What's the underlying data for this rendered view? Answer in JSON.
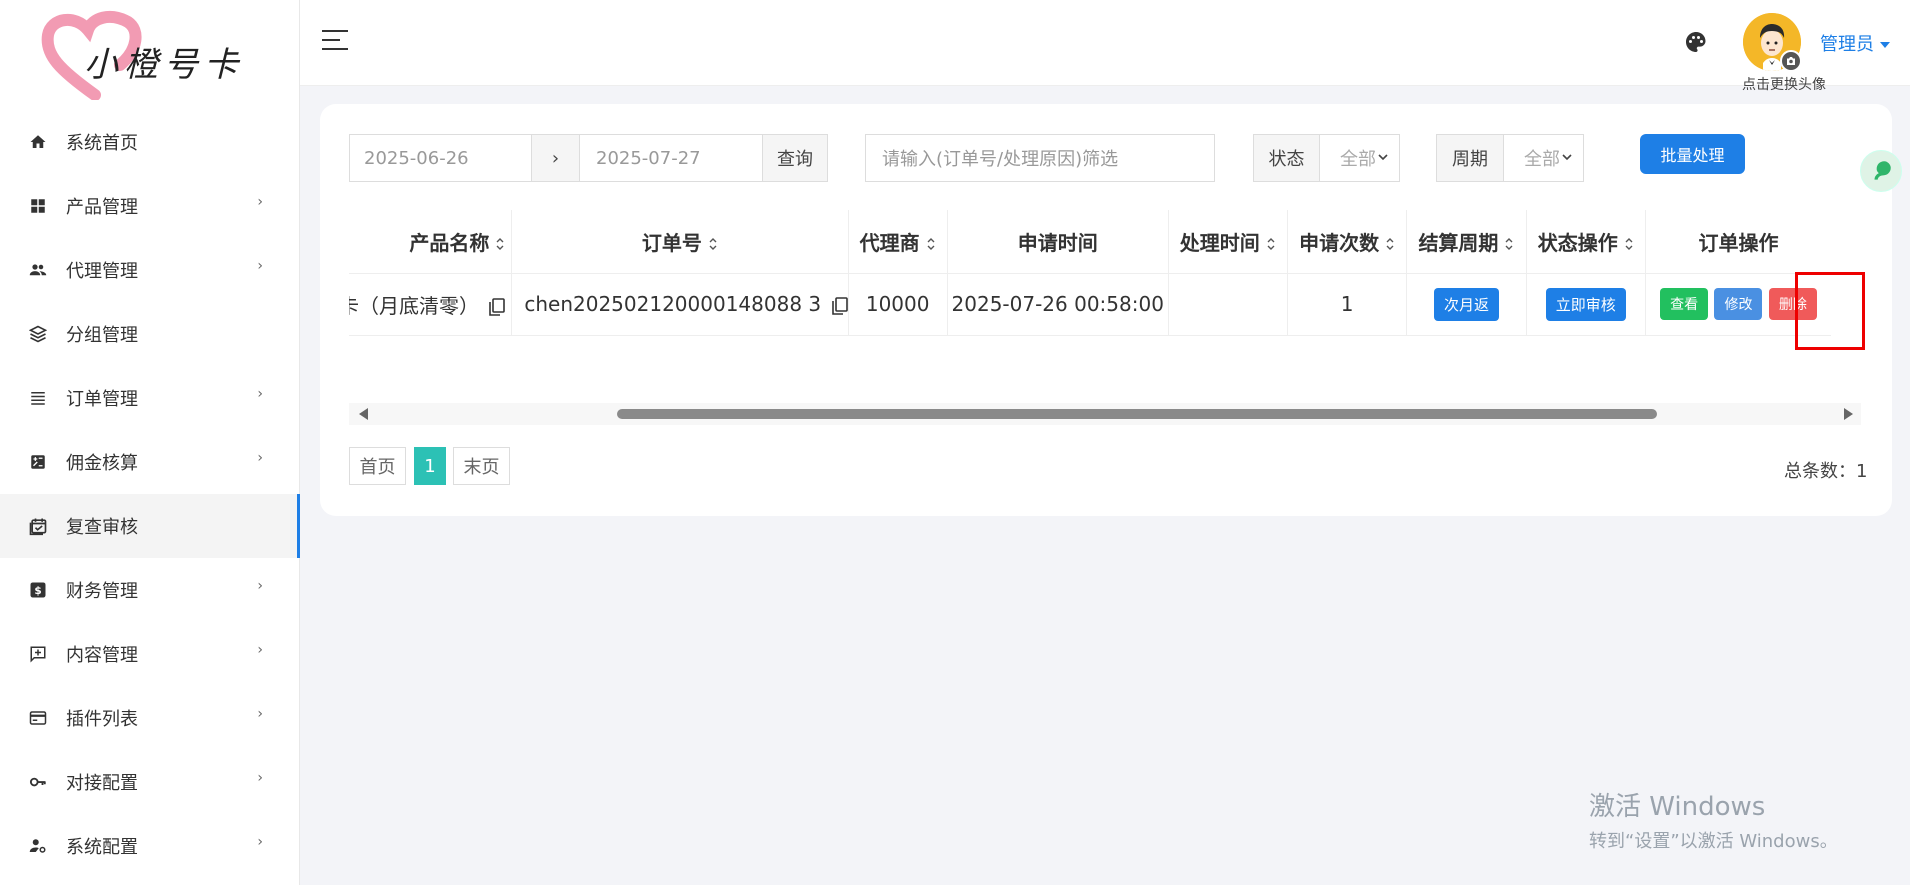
{
  "app": {
    "logo_text": "小橙号卡"
  },
  "sidebar": {
    "items": [
      {
        "label": "系统首页",
        "icon": "home-icon",
        "has_submenu": false
      },
      {
        "label": "产品管理",
        "icon": "grid-icon",
        "has_submenu": true
      },
      {
        "label": "代理管理",
        "icon": "people-icon",
        "has_submenu": true
      },
      {
        "label": "分组管理",
        "icon": "layers-icon",
        "has_submenu": false
      },
      {
        "label": "订单管理",
        "icon": "list-icon",
        "has_submenu": true
      },
      {
        "label": "佣金核算",
        "icon": "calc-icon",
        "has_submenu": true
      },
      {
        "label": "复查审核",
        "icon": "calendar-check-icon",
        "has_submenu": false,
        "active": true
      },
      {
        "label": "财务管理",
        "icon": "dollar-icon",
        "has_submenu": true
      },
      {
        "label": "内容管理",
        "icon": "add-comment-icon",
        "has_submenu": true
      },
      {
        "label": "插件列表",
        "icon": "card-icon",
        "has_submenu": true
      },
      {
        "label": "对接配置",
        "icon": "key-icon",
        "has_submenu": true
      },
      {
        "label": "系统配置",
        "icon": "user-gear-icon",
        "has_submenu": true
      }
    ],
    "chevron": "›"
  },
  "header": {
    "avatar_hint": "点击更换头像",
    "user": "管理员"
  },
  "filters": {
    "date_start": "2025-06-26",
    "date_sep": "›",
    "date_end": "2025-07-27",
    "query_label": "查询",
    "search_placeholder": "请输入(订单号/处理原因)筛选",
    "status_label": "状态",
    "status_value": "全部",
    "period_label": "周期",
    "period_value": "全部",
    "batch_button": "批量处理"
  },
  "table": {
    "columns": [
      "产品名称",
      "订单号",
      "代理商",
      "申请时间",
      "处理时间",
      "申请次数",
      "结算周期",
      "状态操作",
      "订单操作"
    ],
    "rows": [
      {
        "product": "号卡（月底清零）",
        "order_no": "chen202502120000148088 3",
        "agent": "10000",
        "apply_time": "2025-07-26 00:58:00",
        "process_time": "",
        "apply_count": "1",
        "period_btn": "次月返",
        "status_btn": "立即审核",
        "view_btn": "查看",
        "edit_btn": "修改",
        "delete_btn": "删除"
      }
    ]
  },
  "pagination": {
    "first": "首页",
    "current": "1",
    "last": "末页",
    "total": "总条数：1"
  },
  "watermark": {
    "line1": "激活 Windows",
    "line2": "转到“设置”以激活 Windows。"
  },
  "colors": {
    "primary": "#1e7fe6",
    "success": "#22c05f",
    "danger": "#f05a5a",
    "page_active": "#2cc1b5"
  }
}
